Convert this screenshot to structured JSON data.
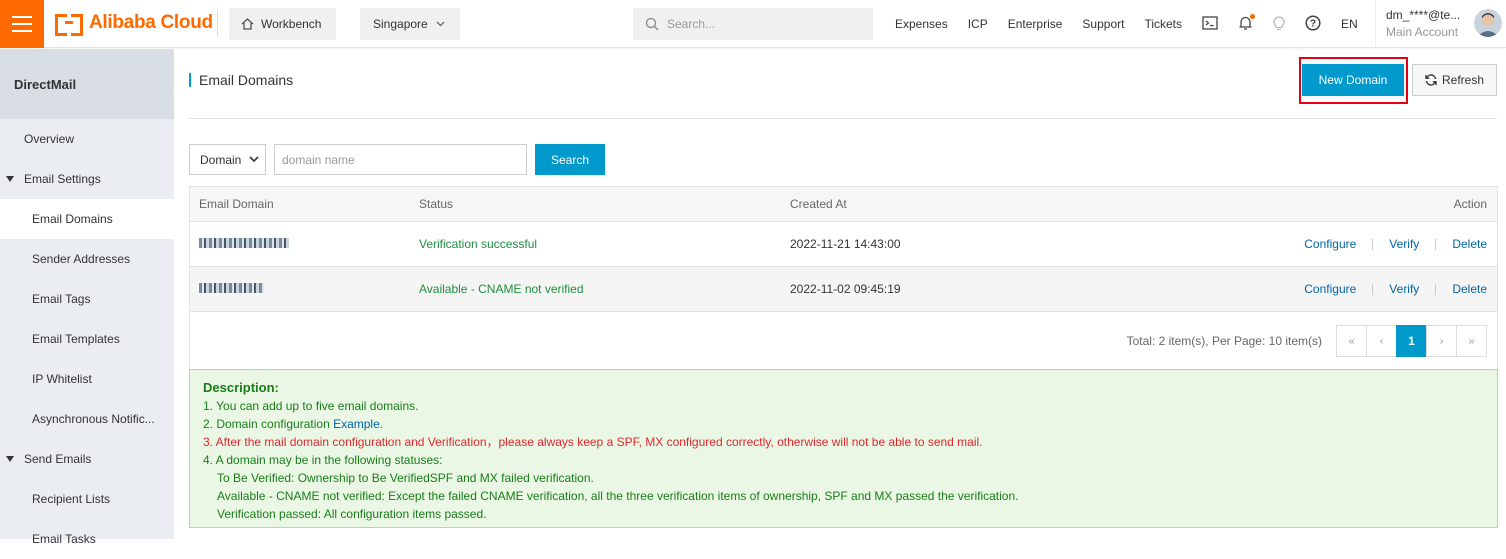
{
  "topbar": {
    "brand": "Alibaba Cloud",
    "workbench": "Workbench",
    "region": "Singapore",
    "search_placeholder": "Search...",
    "nav": [
      "Expenses",
      "ICP",
      "Enterprise",
      "Support",
      "Tickets"
    ],
    "lang": "EN",
    "account_name": "dm_****@te...",
    "account_type": "Main Account"
  },
  "sidebar": {
    "title": "DirectMail",
    "items": [
      {
        "label": "Overview"
      },
      {
        "label": "Email Settings"
      },
      {
        "label": "Email Domains"
      },
      {
        "label": "Sender Addresses"
      },
      {
        "label": "Email Tags"
      },
      {
        "label": "Email Templates"
      },
      {
        "label": "IP Whitelist"
      },
      {
        "label": "Asynchronous Notific..."
      },
      {
        "label": "Send Emails"
      },
      {
        "label": "Recipient Lists"
      },
      {
        "label": "Email Tasks"
      }
    ]
  },
  "page": {
    "title": "Email Domains",
    "new_button": "New Domain",
    "refresh_button": "Refresh"
  },
  "filter": {
    "select_value": "Domain",
    "input_placeholder": "domain name",
    "search_button": "Search"
  },
  "table": {
    "headers": [
      "Email Domain",
      "Status",
      "Created At",
      "Action"
    ],
    "rows": [
      {
        "status": "Verification successful",
        "created": "2022-11-21 14:43:00"
      },
      {
        "status": "Available - CNAME not verified",
        "created": "2022-11-02 09:45:19"
      }
    ],
    "actions": [
      "Configure",
      "Verify",
      "Delete"
    ],
    "summary": "Total: 2 item(s), Per Page: 10 item(s)",
    "pager": {
      "first": "«",
      "prev": "‹",
      "current": "1",
      "next": "›",
      "last": "»"
    }
  },
  "description": {
    "title": "Description:",
    "line1": "1. You can add up to five email domains.",
    "line2_prefix": "2. Domain configuration ",
    "line2_link": "Example",
    "line2_suffix": ".",
    "line3": "3. After the mail domain configuration and Verification，please always keep a SPF, MX configured correctly, otherwise will not be able to send mail.",
    "line4": "4. A domain may be in the following statuses:",
    "status1": "To Be Verified: Ownership to Be VerifiedSPF and MX failed verification.",
    "status2": "Available - CNAME not verified: Except the failed CNAME verification, all the three verification items of ownership, SPF and MX passed the verification.",
    "status3": "Verification passed: All configuration items passed."
  }
}
